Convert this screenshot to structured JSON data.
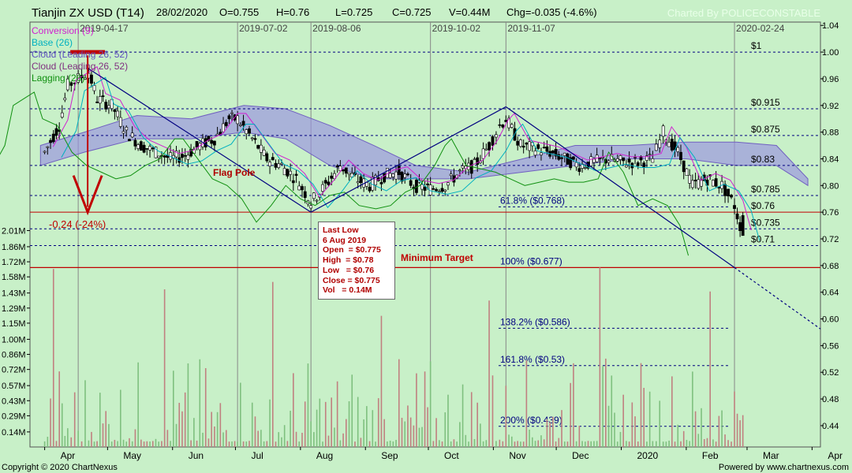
{
  "header": {
    "title": "Tianjin ZX USD (T14)",
    "date": "28/02/2020",
    "open": "O=0.755",
    "high": "H=0.76",
    "low": "L=0.725",
    "close": "C=0.725",
    "volume": "V=0.44M",
    "change": "Chg=-0.035 (-4.6%)",
    "watermark": "Charted By POLICECONSTABLE"
  },
  "footer": {
    "left": "Copyright © 2020 ChartNexus",
    "right": "Powered by www.chartnexus.com"
  },
  "legend": [
    {
      "label": "Conversion (9)",
      "color": "#d020d0"
    },
    {
      "label": "Base (26)",
      "color": "#00b0c0"
    },
    {
      "label": "Cloud (Leading 26, 52)",
      "color": "#6050c0"
    },
    {
      "label": "Cloud (Leading 26, 52)",
      "color": "#803080"
    },
    {
      "label": "Lagging (26)",
      "color": "#109010"
    }
  ],
  "annotations": {
    "flag_pole": "Flag Pole",
    "drop": "-0.24 (-24%)",
    "minimum_target": "Minimum Target"
  },
  "infobox": {
    "title": "Last Low",
    "date": "6 Aug 2019",
    "open": "Open  = $0.775",
    "high": "High  = $0.78",
    "low": "Low   = $0.76",
    "close": "Close = $0.775",
    "vol": "Vol   = 0.14M"
  },
  "chart_data": {
    "type": "candlestick",
    "colors": {
      "background": "#c8f0c8",
      "up": "#ffffff",
      "down": "#000000",
      "trendline": "#000080",
      "target": "#c00000",
      "vol_up": "#7fc07f",
      "vol_down": "#c08080"
    },
    "price_axis": {
      "ticks": [
        0.44,
        0.48,
        0.52,
        0.56,
        0.6,
        0.64,
        0.68,
        0.72,
        0.76,
        0.8,
        0.84,
        0.88,
        0.92,
        0.96,
        1.0,
        1.04
      ],
      "range": [
        0.408,
        1.045
      ]
    },
    "volume_axis": {
      "labels": [
        "0.14M",
        "0.29M",
        "0.43M",
        "0.57M",
        "0.72M",
        "0.86M",
        "1.00M",
        "1.15M",
        "1.29M",
        "1.43M",
        "1.58M",
        "1.72M",
        "1.86M",
        "2.01M"
      ],
      "max": 2.05
    },
    "month_labels": [
      "Apr",
      "May",
      "Jun",
      "Jul",
      "Aug",
      "Sep",
      "Oct",
      "Nov",
      "Dec",
      "2020",
      "Feb",
      "Mar",
      "Apr"
    ],
    "date_markers": [
      "2019-04-17",
      "2019-07-02",
      "2019-08-06",
      "2019-10-02",
      "2019-11-07",
      "2020-02-24"
    ],
    "price_levels": [
      {
        "label": "$1",
        "value": 1.0
      },
      {
        "label": "$0.915",
        "value": 0.915
      },
      {
        "label": "$0.875",
        "value": 0.875
      },
      {
        "label": "$0.83",
        "value": 0.83
      },
      {
        "label": "$0.785",
        "value": 0.785
      },
      {
        "label": "$0.76",
        "value": 0.76
      },
      {
        "label": "$0.735",
        "value": 0.735
      },
      {
        "label": "$0.71",
        "value": 0.71
      }
    ],
    "fib_levels": [
      {
        "label": "61.8%  ($0.768)",
        "value": 0.768
      },
      {
        "label": "100%  ($0.677)",
        "value": 0.677
      },
      {
        "label": "138.2%  ($0.586)",
        "value": 0.586
      },
      {
        "label": "161.8%  ($0.53)",
        "value": 0.53
      },
      {
        "label": "200%  ($0.439)",
        "value": 0.439
      }
    ],
    "close_path": [
      [
        "2019-04-01",
        0.85
      ],
      [
        "2019-04-08",
        0.89
      ],
      [
        "2019-04-12",
        0.95
      ],
      [
        "2019-04-17",
        0.96
      ],
      [
        "2019-04-22",
        0.97
      ],
      [
        "2019-04-26",
        0.93
      ],
      [
        "2019-05-03",
        0.92
      ],
      [
        "2019-05-10",
        0.88
      ],
      [
        "2019-05-17",
        0.86
      ],
      [
        "2019-05-24",
        0.85
      ],
      [
        "2019-05-31",
        0.84
      ],
      [
        "2019-06-07",
        0.845
      ],
      [
        "2019-06-14",
        0.86
      ],
      [
        "2019-06-21",
        0.87
      ],
      [
        "2019-06-28",
        0.9
      ],
      [
        "2019-07-02",
        0.9
      ],
      [
        "2019-07-09",
        0.87
      ],
      [
        "2019-07-16",
        0.84
      ],
      [
        "2019-07-23",
        0.83
      ],
      [
        "2019-07-30",
        0.81
      ],
      [
        "2019-08-06",
        0.775
      ],
      [
        "2019-08-13",
        0.8
      ],
      [
        "2019-08-20",
        0.83
      ],
      [
        "2019-08-27",
        0.81
      ],
      [
        "2019-09-03",
        0.8
      ],
      [
        "2019-09-10",
        0.815
      ],
      [
        "2019-09-17",
        0.82
      ],
      [
        "2019-09-24",
        0.8
      ],
      [
        "2019-10-02",
        0.795
      ],
      [
        "2019-10-09",
        0.8
      ],
      [
        "2019-10-16",
        0.82
      ],
      [
        "2019-10-23",
        0.83
      ],
      [
        "2019-10-30",
        0.86
      ],
      [
        "2019-11-04",
        0.89
      ],
      [
        "2019-11-07",
        0.9
      ],
      [
        "2019-11-14",
        0.86
      ],
      [
        "2019-11-21",
        0.855
      ],
      [
        "2019-11-28",
        0.85
      ],
      [
        "2019-12-05",
        0.84
      ],
      [
        "2019-12-12",
        0.83
      ],
      [
        "2019-12-19",
        0.835
      ],
      [
        "2019-12-26",
        0.84
      ],
      [
        "2020-01-02",
        0.835
      ],
      [
        "2020-01-09",
        0.835
      ],
      [
        "2020-01-16",
        0.84
      ],
      [
        "2020-01-21",
        0.88
      ],
      [
        "2020-01-28",
        0.85
      ],
      [
        "2020-02-04",
        0.8
      ],
      [
        "2020-02-11",
        0.81
      ],
      [
        "2020-02-18",
        0.8
      ],
      [
        "2020-02-24",
        0.77
      ],
      [
        "2020-02-28",
        0.725
      ]
    ],
    "last_low": {
      "date": "2019-08-06",
      "open": 0.775,
      "high": 0.78,
      "low": 0.76,
      "close": 0.775,
      "vol_m": 0.14
    },
    "last_bar": {
      "date": "2020-02-28",
      "open": 0.755,
      "high": 0.76,
      "low": 0.725,
      "close": 0.725,
      "vol_m": 0.44
    }
  }
}
